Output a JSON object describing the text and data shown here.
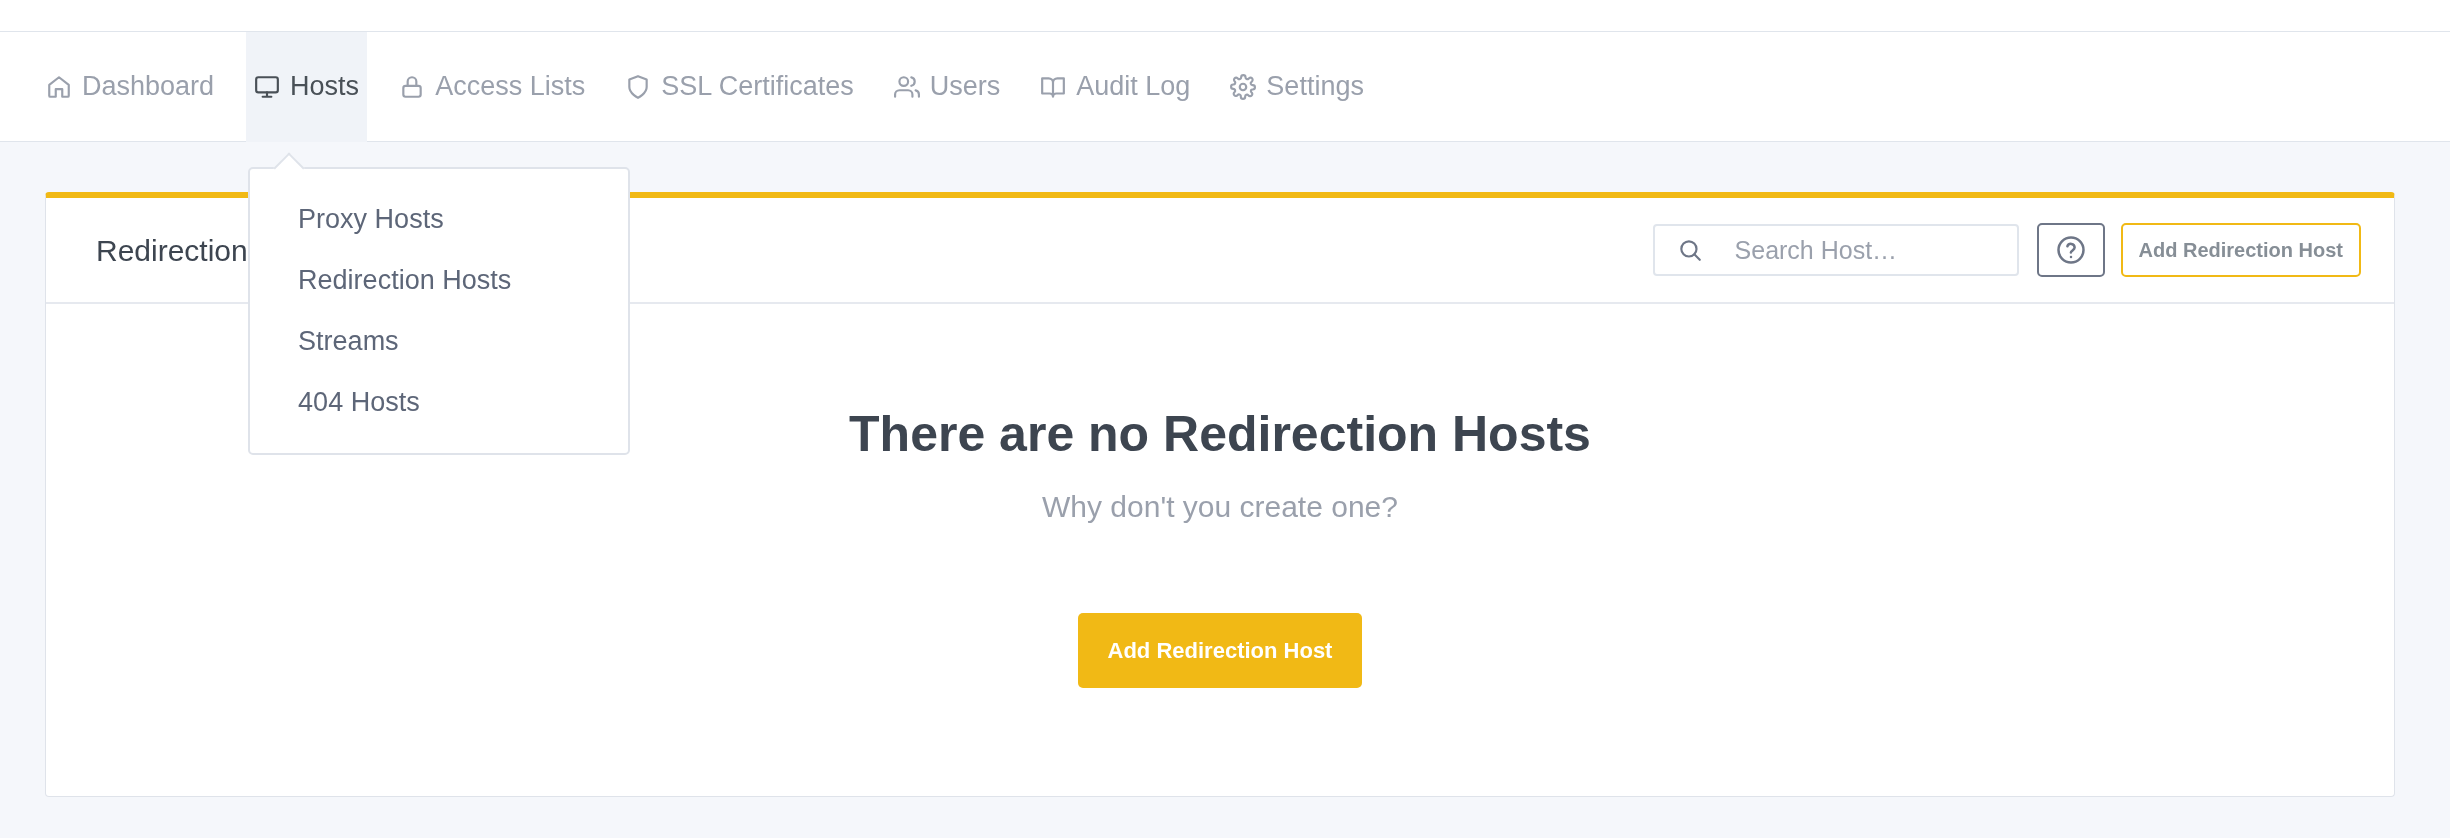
{
  "nav": {
    "items": [
      {
        "label": "Dashboard",
        "selected": false
      },
      {
        "label": "Hosts",
        "selected": true
      },
      {
        "label": "Access Lists",
        "selected": false
      },
      {
        "label": "SSL Certificates",
        "selected": false
      },
      {
        "label": "Users",
        "selected": false
      },
      {
        "label": "Audit Log",
        "selected": false
      },
      {
        "label": "Settings",
        "selected": false
      }
    ]
  },
  "dropdown": {
    "open": true,
    "items": [
      {
        "label": "Proxy Hosts"
      },
      {
        "label": "Redirection Hosts"
      },
      {
        "label": "Streams"
      },
      {
        "label": "404 Hosts"
      }
    ]
  },
  "card": {
    "title": "Redirection",
    "search": {
      "placeholder": "Search Host…"
    },
    "header_button": "Add Redirection Host",
    "empty_state": {
      "heading": "There are no Redirection Hosts",
      "subtitle": "Why don't you create one?",
      "button": "Add Redirection Host"
    }
  }
}
